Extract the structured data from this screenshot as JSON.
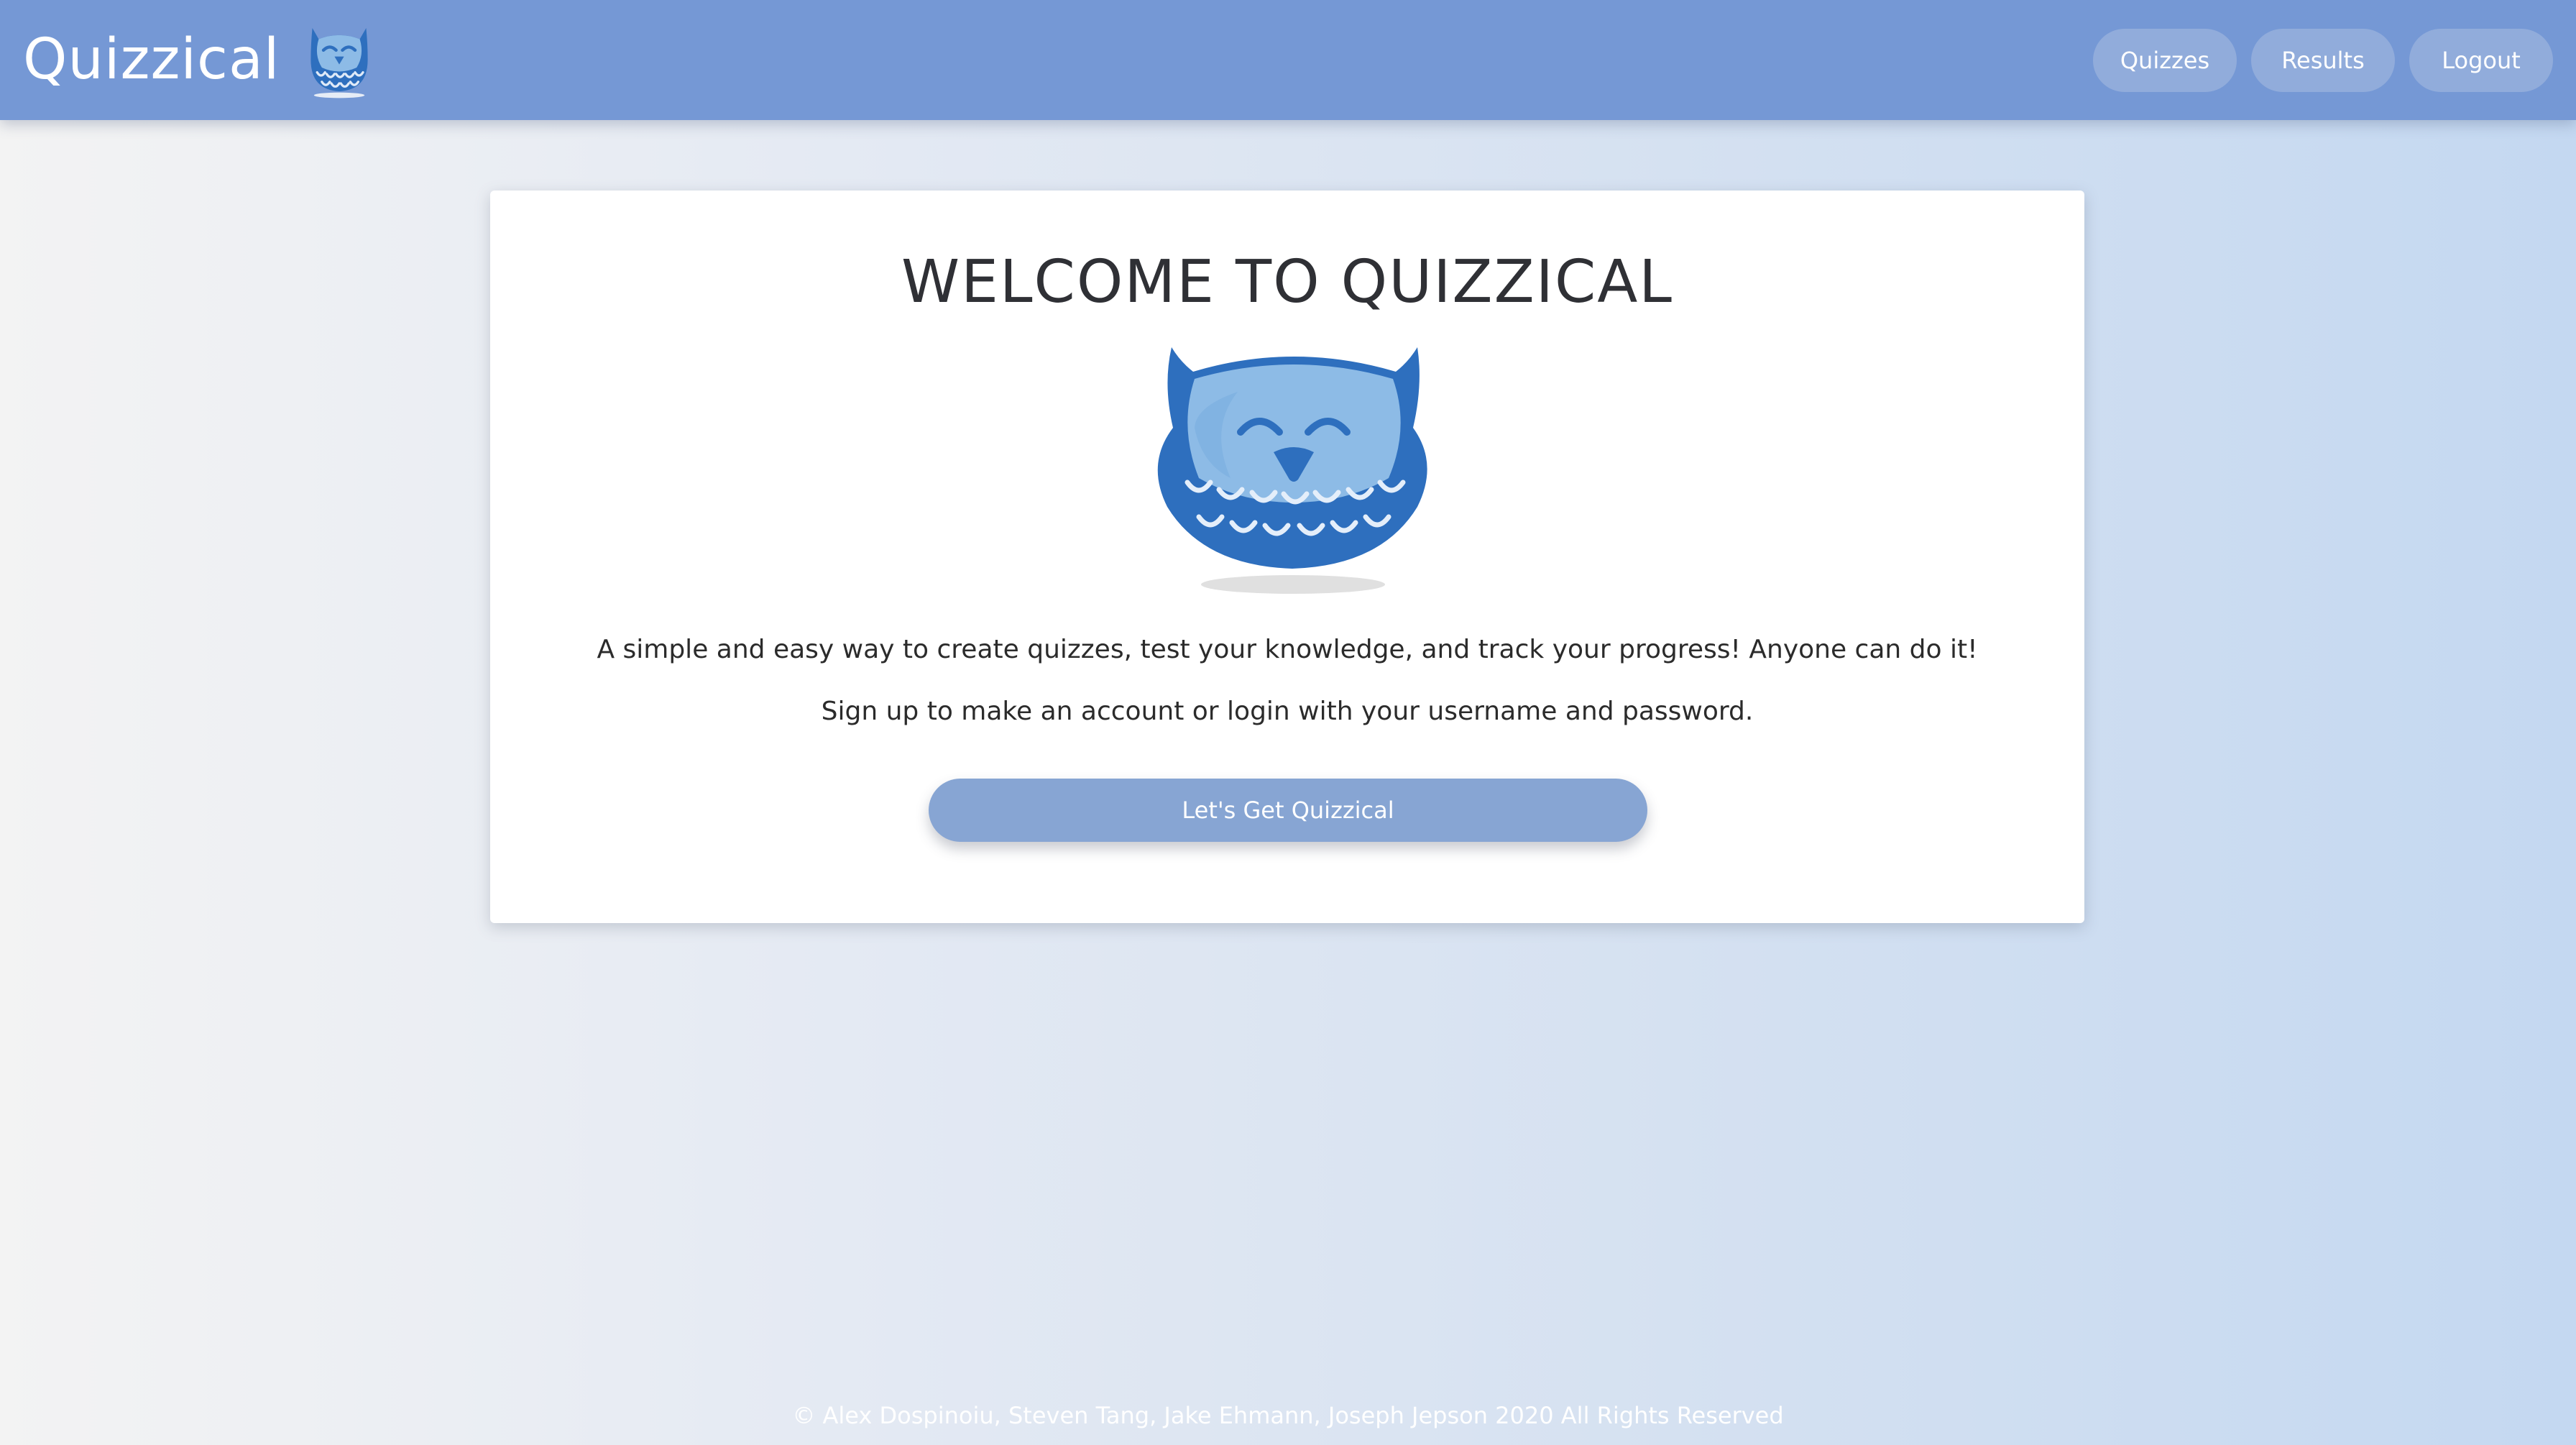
{
  "navbar": {
    "brand": "Quizzical",
    "logo_icon": "owl-icon",
    "buttons": {
      "quizzes": "Quizzes",
      "results": "Results",
      "logout": "Logout"
    }
  },
  "main": {
    "title": "WELCOME TO QUIZZICAL",
    "hero_icon": "owl-icon",
    "description_1": "A simple and easy way to create quizzes, test your knowledge, and track your progress! Anyone can do it!",
    "description_2": "Sign up to make an account or login with your username and password.",
    "cta_label": "Let's Get Quizzical"
  },
  "footer": {
    "text": "© Alex Dospinoiu, Steven Tang, Jake Ehmann, Joseph Jepson 2020 All Rights Reserved"
  },
  "colors": {
    "navbar": "#7598d5",
    "nav_button": "#91acdb",
    "cta": "#87a5d3",
    "owl_dark": "#2e6fbe",
    "owl_light": "#8dbbe6"
  }
}
